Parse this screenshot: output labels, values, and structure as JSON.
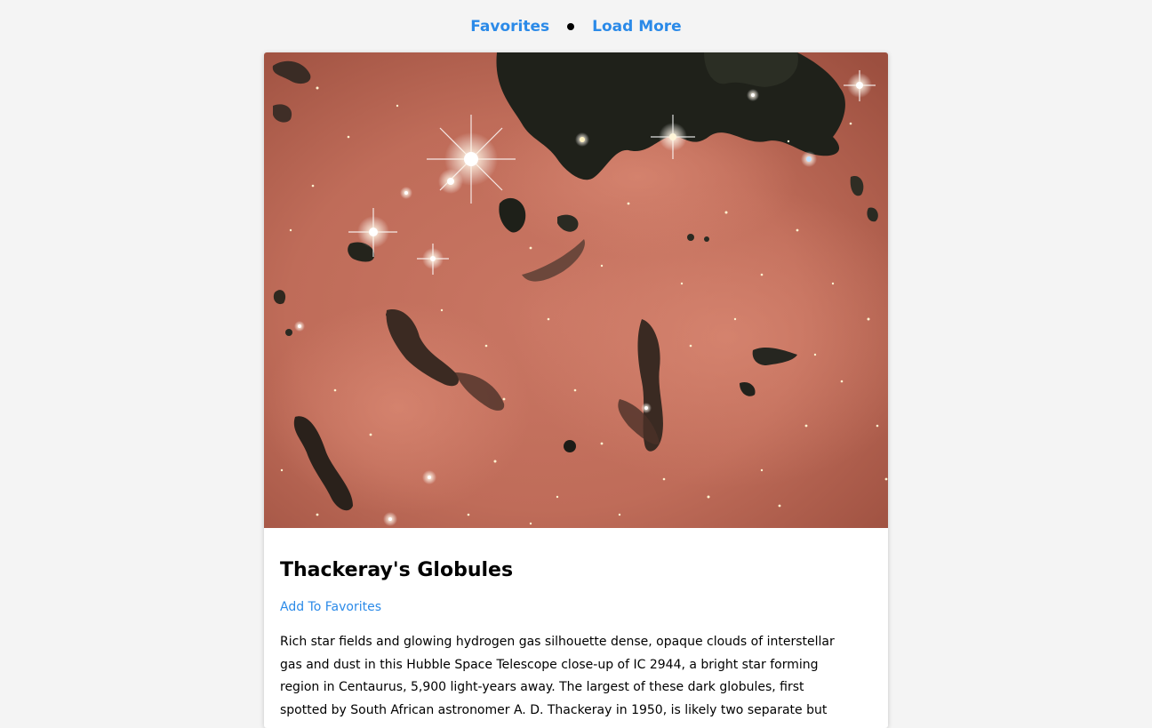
{
  "nav": {
    "favorites_label": "Favorites",
    "load_more_label": "Load More"
  },
  "card": {
    "image_alt": "Thackeray's Globules",
    "title": "Thackeray's Globules",
    "add_favorites_label": "Add To Favorites",
    "explanation": "Rich star fields and glowing hydrogen gas silhouette dense, opaque clouds of interstellar gas and dust in this Hubble Space Telescope close-up of IC 2944, a bright star forming region in Centaurus, 5,900 light-years away. The largest of these dark globules, first spotted by South African astronomer A. D. Thackeray in 1950, is likely two separate but"
  },
  "colors": {
    "background": "#f4f4f4",
    "link": "#2b8ae8",
    "card": "#ffffff",
    "nebula": "#c4705e"
  }
}
